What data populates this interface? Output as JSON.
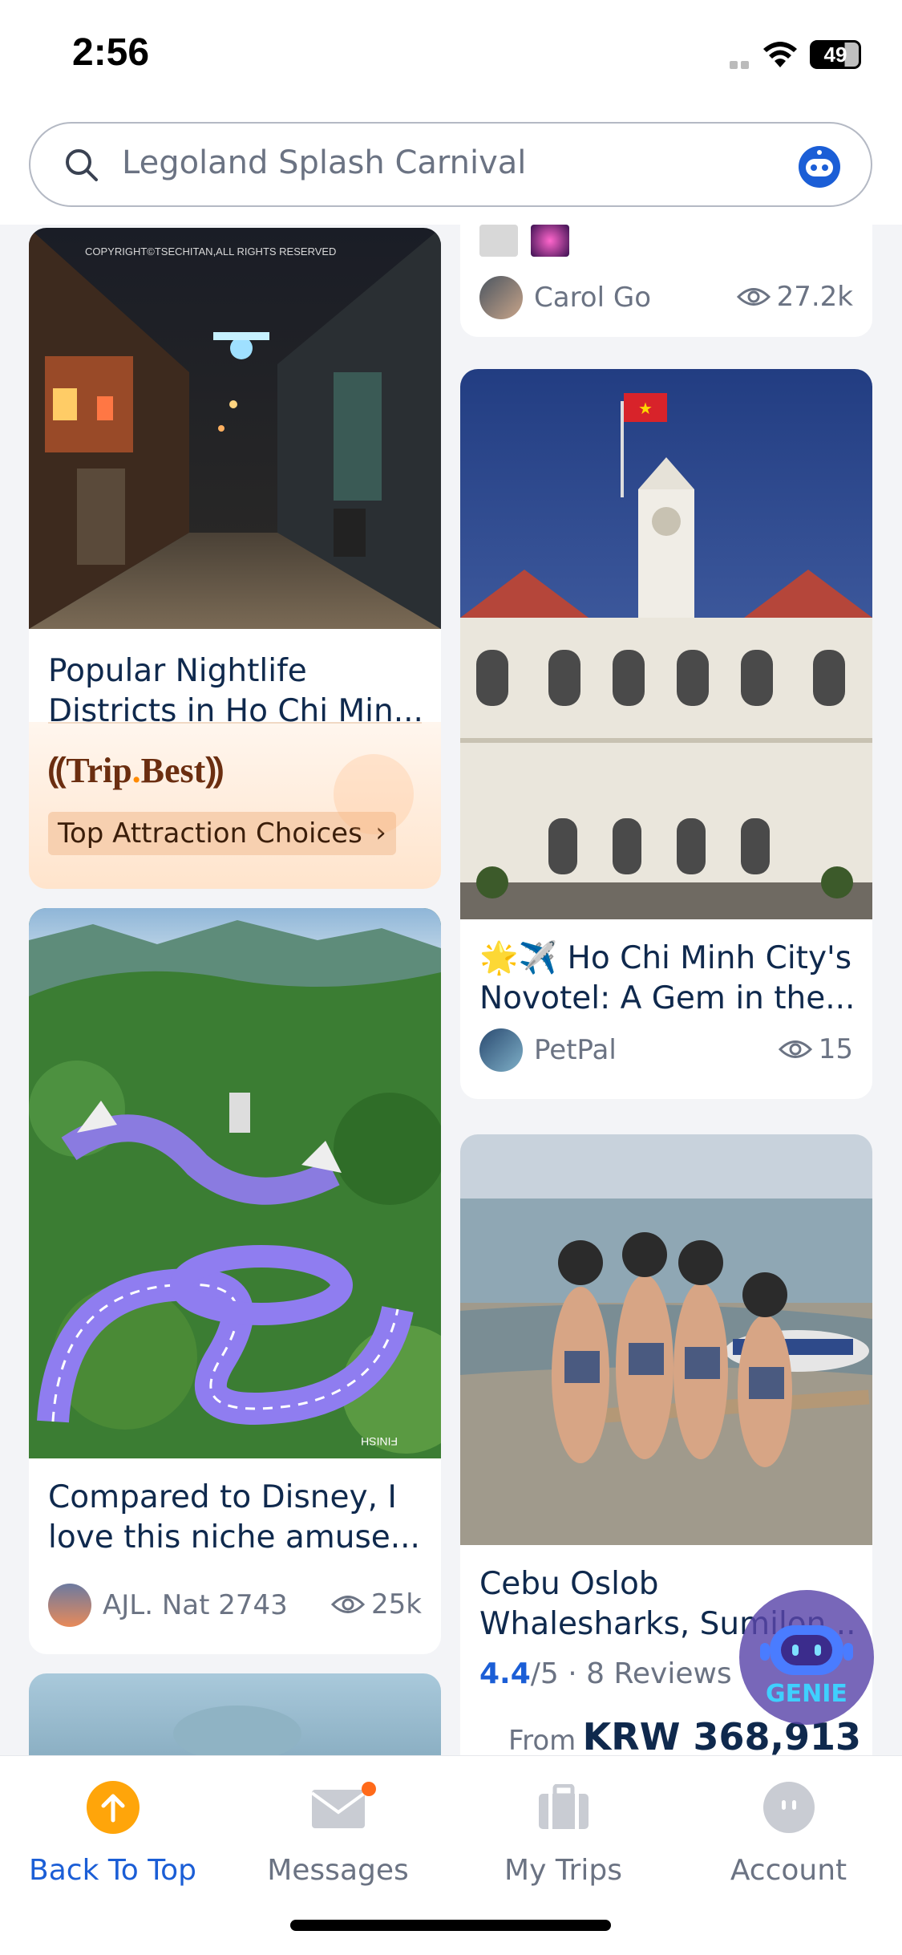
{
  "status": {
    "time": "2:56",
    "battery": "49"
  },
  "search": {
    "placeholder": "Legoland Splash Carnival"
  },
  "feed": {
    "left": [
      {
        "title": "Popular Nightlife Districts in Ho Chi Min...",
        "image_watermark": "COPYRIGHT©TSECHITAN,ALL RIGHTS RESERVED",
        "badge": {
          "brand_a": "Trip",
          "brand_dot": ".",
          "brand_b": "Best",
          "cta": "Top Attraction Choices"
        }
      },
      {
        "title": "Compared to Disney, I love this niche amuse...",
        "author": "AJL. Nat 2743",
        "views": "25k",
        "image_sign": "FINISH"
      }
    ],
    "right": [
      {
        "author": "Carol Go",
        "views": "27.2k"
      },
      {
        "title": "🌟✈️ Ho Chi Minh City's Novotel: A Gem in the...",
        "author": "PetPal",
        "views": "15"
      },
      {
        "title": "Cebu Oslob Whalesharks, Sumilon...",
        "rating": "4.4",
        "rating_suffix": "/5 · 8 Reviews",
        "price_prefix": "From",
        "price": "KRW 368,913"
      }
    ]
  },
  "genie": {
    "label": "GENIE"
  },
  "tabs": [
    {
      "label": "Back To Top",
      "icon": "arrow-up-icon"
    },
    {
      "label": "Messages",
      "icon": "envelope-icon"
    },
    {
      "label": "My Trips",
      "icon": "suitcase-icon"
    },
    {
      "label": "Account",
      "icon": "account-icon"
    }
  ],
  "colors": {
    "accent": "#1b5ed6",
    "text": "#0f294d",
    "muted": "#6b7383",
    "orange": "#ffa50a"
  }
}
